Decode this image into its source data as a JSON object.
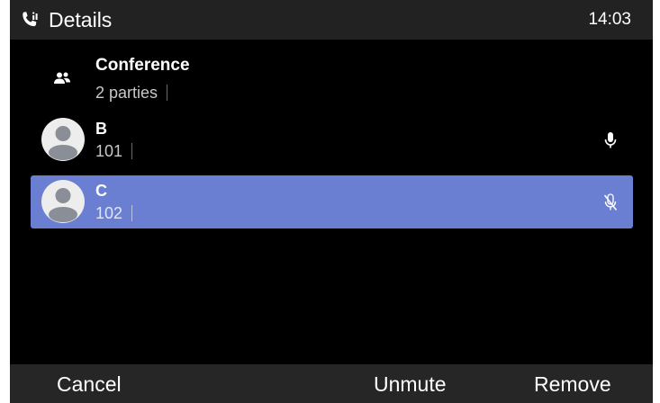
{
  "titlebar": {
    "icon": "phone-call-icon",
    "title": "Details",
    "time": "14:03"
  },
  "conference": {
    "icon": "group-icon",
    "name": "Conference",
    "parties": "2 parties"
  },
  "participants": [
    {
      "name": "B",
      "number": "101",
      "mic_state": "unmuted",
      "icon": "microphone-icon",
      "selected": false
    },
    {
      "name": "C",
      "number": "102",
      "mic_state": "muted",
      "icon": "microphone-off-icon",
      "selected": true
    }
  ],
  "softkeys": {
    "cancel": "Cancel",
    "unmute": "Unmute",
    "remove": "Remove"
  },
  "colors": {
    "background": "#000000",
    "titlebar": "#222222",
    "softkey_bar": "#262626",
    "selection": "#6a7fd1"
  }
}
